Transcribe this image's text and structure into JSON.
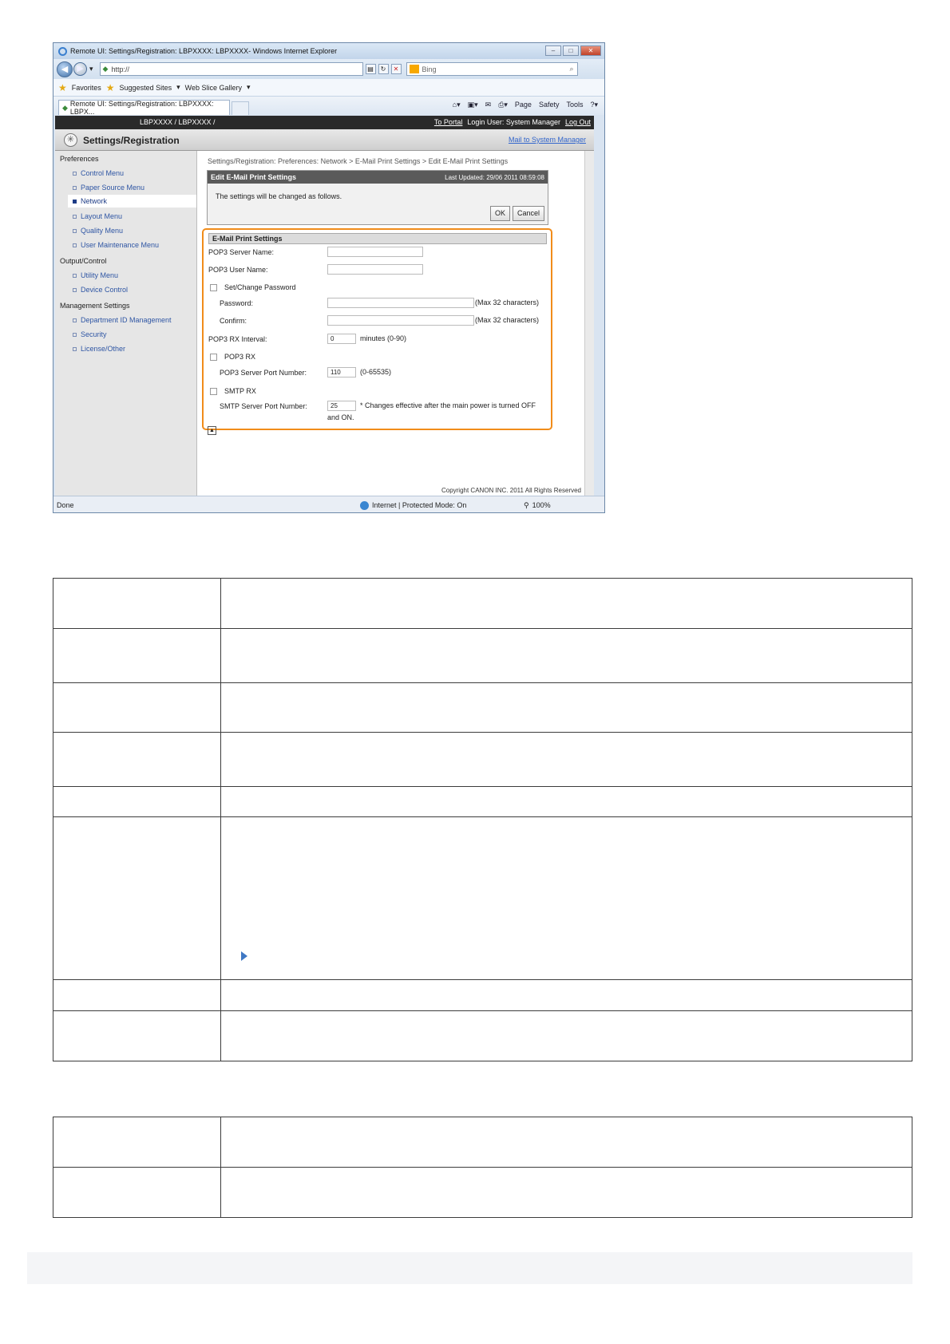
{
  "browser": {
    "window_title": "Remote UI: Settings/Registration: LBPXXXX: LBPXXXX- Windows Internet Explorer",
    "url": "http://",
    "search_placeholder": "Bing",
    "favorites_label": "Favorites",
    "suggested_sites": "Suggested Sites",
    "web_slice_gallery": "Web Slice Gallery",
    "tab_title": "Remote UI: Settings/Registration: LBPXXXX: LBPX...",
    "cmd_page": "Page",
    "cmd_safety": "Safety",
    "cmd_tools": "Tools",
    "status_done": "Done",
    "status_zone": "Internet | Protected Mode: On",
    "zoom": "100%"
  },
  "header": {
    "device": "LBPXXXX / LBPXXXX /",
    "to_portal": "To Portal",
    "login_user": "Login User: System Manager",
    "log_out": "Log Out",
    "title": "Settings/Registration",
    "mail_link": "Mail to System Manager"
  },
  "sidebar": {
    "preferences": "Preferences",
    "output_control": "Output/Control",
    "management": "Management Settings",
    "items": {
      "control_menu": "Control Menu",
      "paper_source": "Paper Source Menu",
      "network": "Network",
      "layout": "Layout Menu",
      "quality": "Quality Menu",
      "user_maint": "User Maintenance Menu",
      "utility": "Utility Menu",
      "device_control": "Device Control",
      "dept_id": "Department ID Management",
      "security": "Security",
      "license": "License/Other"
    }
  },
  "content": {
    "breadcrumb": "Settings/Registration: Preferences: Network > E-Mail Print Settings > Edit E-Mail Print Settings",
    "edit_title": "Edit E-Mail Print Settings",
    "last_updated": "Last Updated: 29/06 2011 08:59:08",
    "message": "The settings will be changed as follows.",
    "ok": "OK",
    "cancel": "Cancel",
    "form_title": "E-Mail Print Settings",
    "pop3_server_name": "POP3 Server Name:",
    "pop3_user_name": "POP3 User Name:",
    "set_change_password": "Set/Change Password",
    "password": "Password:",
    "confirm": "Confirm:",
    "max32": "(Max 32 characters)",
    "pop3_rx_interval": "POP3 RX Interval:",
    "interval_value": "0",
    "minutes_range": "minutes (0-90)",
    "pop3_rx": "POP3 RX",
    "pop3_port_label": "POP3 Server Port Number:",
    "pop3_port_value": "110",
    "port_range": "(0-65535)",
    "smtp_rx": "SMTP RX",
    "smtp_port_label": "SMTP Server Port Number:",
    "smtp_port_value": "25",
    "smtp_note_1": "* Changes effective after the main power is turned OFF",
    "smtp_note_2": "and ON.",
    "copyright": "Copyright CANON INC. 2011 All Rights Reserved"
  }
}
